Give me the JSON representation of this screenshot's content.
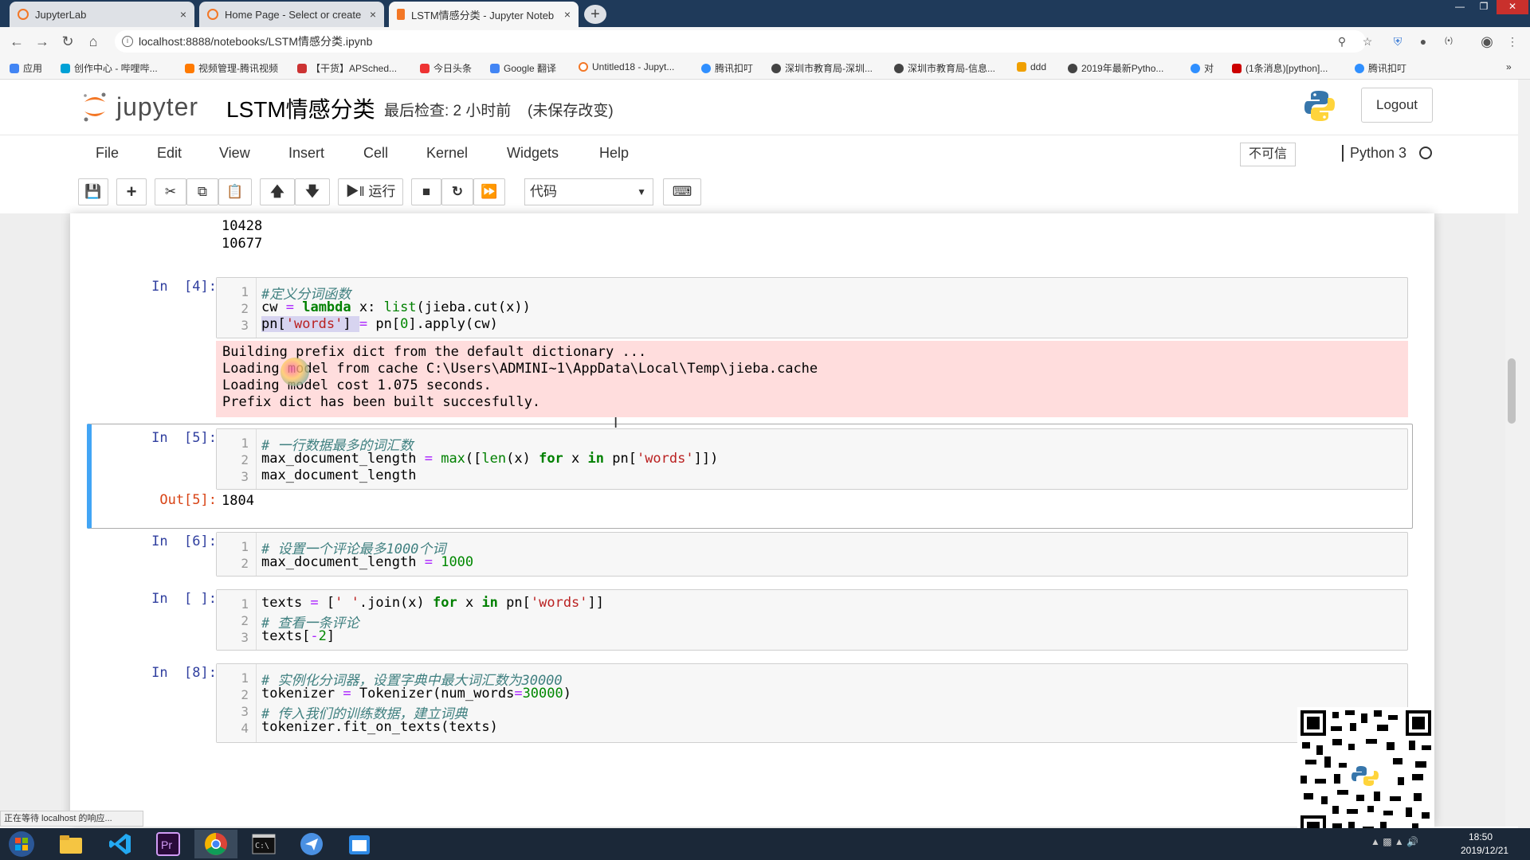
{
  "browser": {
    "tabs": [
      {
        "title": "JupyterLab"
      },
      {
        "title": "Home Page - Select or create"
      },
      {
        "title": "LSTM情感分类 - Jupyter Noteb"
      }
    ],
    "close_glyph": "×",
    "url": "localhost:8888/notebooks/LSTM情感分类.ipynb",
    "bookmarks": [
      {
        "label": "应用",
        "color": "#4285f4"
      },
      {
        "label": "创作中心 - 哔哩哔...",
        "color": "#00a1d6"
      },
      {
        "label": "视频管理-腾讯视频",
        "color": "#ff7a00"
      },
      {
        "label": "【干货】APSched...",
        "color": "#c33"
      },
      {
        "label": "今日头条",
        "color": "#e33"
      },
      {
        "label": "Google 翻译",
        "color": "#4285f4"
      },
      {
        "label": "Untitled18 - Jupyt...",
        "color": "#f37726"
      },
      {
        "label": "腾讯扣叮",
        "color": "#2f8fff"
      },
      {
        "label": "深圳市教育局-深圳...",
        "color": "#444"
      },
      {
        "label": "深圳市教育局-信息...",
        "color": "#444"
      },
      {
        "label": "ddd",
        "color": "#f0a000"
      },
      {
        "label": "2019年最新Pytho...",
        "color": "#444"
      },
      {
        "label": "对",
        "color": "#2f8fff"
      },
      {
        "label": "(1条消息)[python]...",
        "color": "#c00"
      },
      {
        "label": "腾讯扣叮",
        "color": "#2f8fff"
      }
    ]
  },
  "jupyter": {
    "logo_text": "jupyter",
    "notebook_name": "LSTM情感分类",
    "checkpoint": "最后检查: 2 小时前",
    "autosave": "(未保存改变)",
    "logout": "Logout",
    "menus": [
      "File",
      "Edit",
      "View",
      "Insert",
      "Cell",
      "Kernel",
      "Widgets",
      "Help"
    ],
    "trust": "不可信",
    "kernel": "Python 3",
    "run_label": "运行",
    "cell_type": "代码"
  },
  "notebook": {
    "prev_output": [
      "10428",
      "10677"
    ],
    "cell4": {
      "prompt": "In  [4]:",
      "line_numbers": [
        "1",
        "2",
        "3"
      ],
      "stderr": [
        "Building prefix dict from the default dictionary ...",
        "Loading model from cache C:\\Users\\ADMINI~1\\AppData\\Local\\Temp\\jieba.cache",
        "Loading model cost 1.075 seconds.",
        "Prefix dict has been built succesfully."
      ]
    },
    "cell5": {
      "prompt": "In  [5]:",
      "out_prompt": "Out[5]:",
      "output": "1804",
      "line_numbers": [
        "1",
        "2",
        "3"
      ]
    },
    "cell6": {
      "prompt": "In  [6]:",
      "line_numbers": [
        "1",
        "2"
      ]
    },
    "cell_pending": {
      "prompt": "In  [ ]:",
      "line_numbers": [
        "1",
        "2",
        "3"
      ]
    },
    "cell8": {
      "prompt": "In  [8]:",
      "line_numbers": [
        "1",
        "2",
        "3",
        "4"
      ]
    }
  },
  "status": {
    "loading": "正在等待 localhost 的响应..."
  },
  "taskbar": {
    "time": "18:50",
    "date": "2019/12/21"
  },
  "colors": {
    "jupyter_orange": "#f37726",
    "selected_cell": "#42a5f5",
    "stderr_bg": "#ffdddd"
  }
}
